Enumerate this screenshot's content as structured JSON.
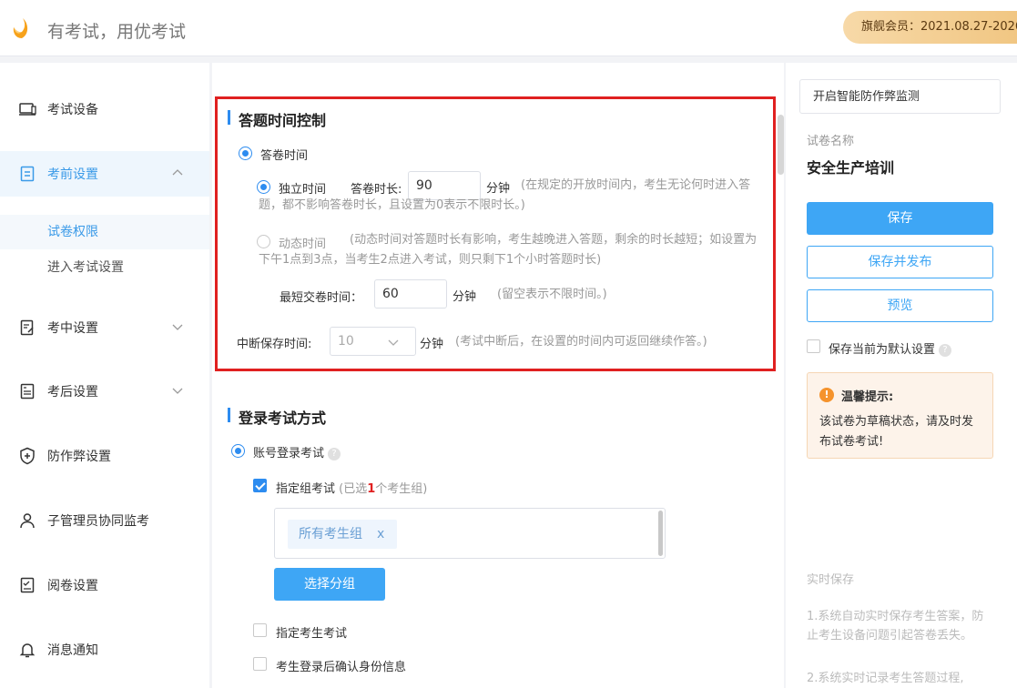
{
  "header": {
    "slogan": "有考试，用优考试",
    "vip_text": "旗舰会员：2021.08.27-2026"
  },
  "sidebar": {
    "items": [
      {
        "label": "考试设备",
        "icon": "laptop-icon"
      },
      {
        "label": "考前设置",
        "icon": "clipboard-icon"
      },
      {
        "label": "考中设置",
        "icon": "edit-doc-icon"
      },
      {
        "label": "考后设置",
        "icon": "report-icon"
      },
      {
        "label": "防作弊设置",
        "icon": "shield-icon"
      },
      {
        "label": "子管理员协同监考",
        "icon": "user-icon"
      },
      {
        "label": "阅卷设置",
        "icon": "grading-icon"
      },
      {
        "label": "消息通知",
        "icon": "bell-icon"
      }
    ],
    "subitems": [
      "试卷权限",
      "进入考试设置"
    ]
  },
  "time_control": {
    "title": "答题时间控制",
    "answer_time_label": "答卷时间",
    "independent_label": "独立时间",
    "duration_label": "答卷时长:",
    "duration_value": "90",
    "minute_unit": "分钟",
    "independent_hint": "(在规定的开放时间内，考生无论何时进入答题，都不影响答卷时长，且设置为0表示不限时长。)",
    "dynamic_label": "动态时间",
    "dynamic_hint": "(动态时间对答题时长有影响，考生越晚进入答题，剩余的时长越短；如设置为下午1点到3点，当考生2点进入考试，则只剩下1个小时答题时长)",
    "min_submit_label": "最短交卷时间：",
    "min_submit_value": "60",
    "min_submit_hint": "(留空表示不限时间。)",
    "interrupt_label": "中断保存时间:",
    "interrupt_value": "10",
    "interrupt_hint": "(考试中断后，在设置的时间内可返回继续作答。)"
  },
  "login": {
    "title": "登录考试方式",
    "account_label": "账号登录考试",
    "group_label": "指定组考试",
    "group_selected_prefix": "(已选",
    "group_selected_count": "1",
    "group_selected_suffix": "个考生组)",
    "group_tag": "所有考生组",
    "group_tag_close": "x",
    "select_group_button": "选择分组",
    "specify_candidate_label": "指定考生考试",
    "confirm_identity_label": "考生登录后确认身份信息"
  },
  "right": {
    "anti_cheat": "开启智能防作弊监测",
    "paper_name_label": "试卷名称",
    "paper_name": "安全生产培训",
    "save": "保存",
    "save_publish": "保存并发布",
    "preview": "预览",
    "default_label": "保存当前为默认设置",
    "tip_title": "温馨提示:",
    "tip_body": "该试卷为草稿状态，请及时发布试卷考试!",
    "realtime_title": "实时保存",
    "realtime_1": "1.系统自动实时保存考生答案，防止考生设备问题引起答卷丢失。",
    "realtime_2": "2.系统实时记录考生答题过程,"
  },
  "colors": {
    "accent": "#2d8cf0",
    "highlight_box": "#e02020",
    "button": "#3ea6f5"
  }
}
